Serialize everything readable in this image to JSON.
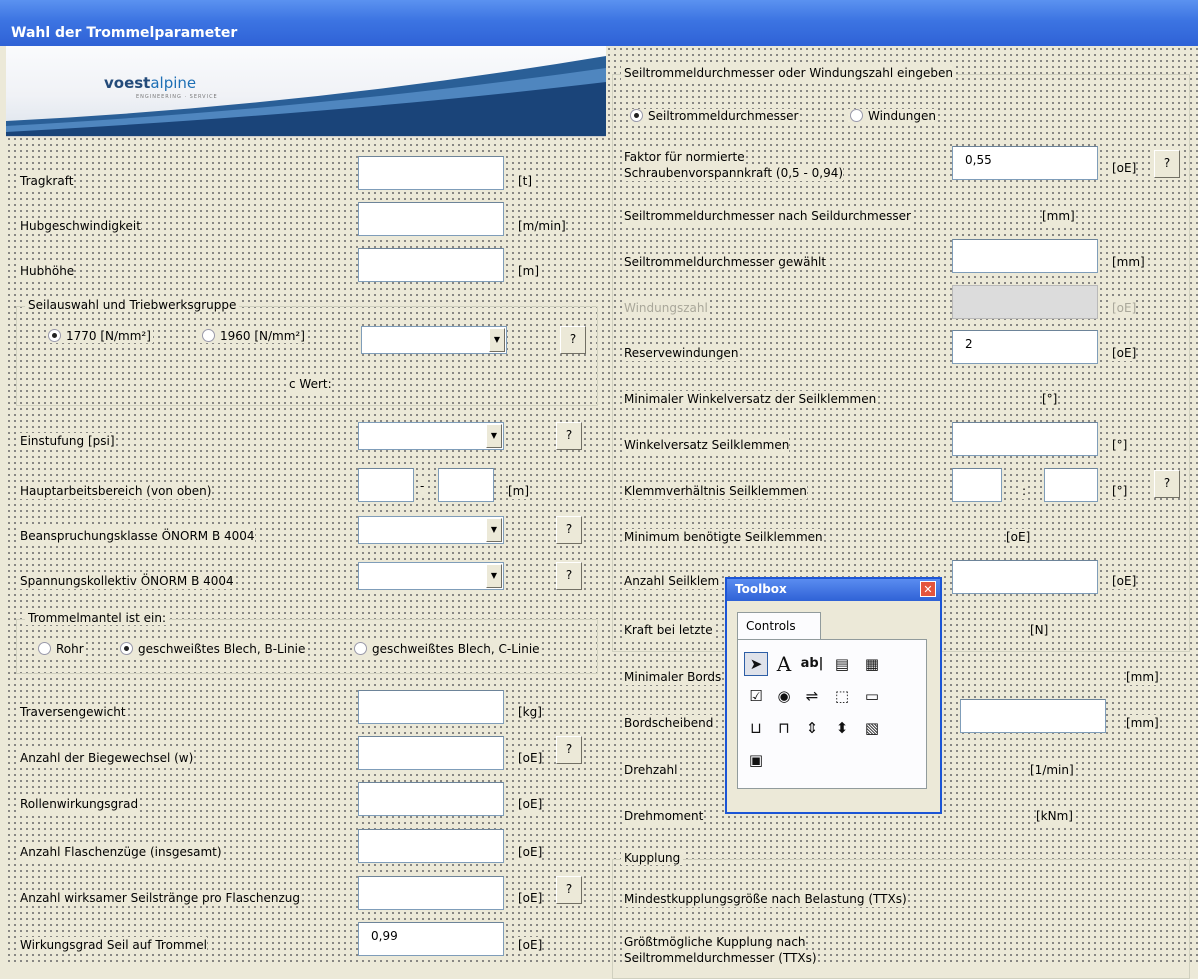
{
  "window": {
    "title": "Wahl der Trommelparameter"
  },
  "logo": {
    "brand_a": "voest",
    "brand_b": "alpine",
    "tagline": "ENGINEERING · SERVICE"
  },
  "left": {
    "tragkraft": {
      "label": "Tragkraft",
      "unit": "[t]"
    },
    "hubgeschw": {
      "label": "Hubgeschwindigkeit",
      "unit": "[m/min]"
    },
    "hubhoehe": {
      "label": "Hubhöhe",
      "unit": "[m]"
    },
    "seilauswahl": {
      "caption": "Seilauswahl und Triebwerksgruppe",
      "opt1": "1770 [N/mm²]",
      "opt2": "1960 [N/mm²]",
      "cwert": "c Wert:",
      "help": "?"
    },
    "einstufung": {
      "label": "Einstufung [psi]",
      "help": "?"
    },
    "hauptarbeit": {
      "label": "Hauptarbeitsbereich (von oben)",
      "sep": "-",
      "unit": "[m]"
    },
    "beanspruchung": {
      "label": "Beanspruchungsklasse ÖNORM B 4004",
      "help": "?"
    },
    "spannung": {
      "label": "Spannungskollektiv ÖNORM B 4004",
      "help": "?"
    },
    "trommelmantel": {
      "caption": "Trommelmantel ist ein:",
      "opt1": "Rohr",
      "opt2": "geschweißtes Blech, B-Linie",
      "opt3": "geschweißtes Blech, C-Linie"
    },
    "traverse": {
      "label": "Traversengewicht",
      "unit": "[kg]"
    },
    "biegewechsel": {
      "label": "Anzahl der Biegewechsel (w)",
      "unit": "[oE]",
      "help": "?"
    },
    "rollen": {
      "label": "Rollenwirkungsgrad",
      "unit": "[oE]"
    },
    "flaschenzuege": {
      "label": "Anzahl Flaschenzüge (insgesamt)",
      "unit": "[oE]"
    },
    "seilstraenge": {
      "label": "Anzahl wirksamer Seilstränge pro Flaschenzug",
      "unit": "[oE]",
      "help": "?"
    },
    "wirkungsgrad": {
      "label": "Wirkungsgrad Seil auf Trommel",
      "value": "0,99",
      "unit": "[oE]"
    }
  },
  "right": {
    "frame_caption": "Seiltrommeldurchmesser oder Windungszahl eingeben",
    "radio1": "Seiltrommeldurchmesser",
    "radio2": "Windungen",
    "faktor": {
      "label1": "Faktor für normierte",
      "label2": "Schraubenvorspannkraft (0,5 - 0,94)",
      "value": "0,55",
      "unit": "[oE]",
      "help": "?"
    },
    "std_nach": {
      "label": "Seiltrommeldurchmesser nach Seildurchmesser",
      "unit": "[mm]"
    },
    "std_gew": {
      "label": "Seiltrommeldurchmesser gewählt",
      "unit": "[mm]"
    },
    "windungszahl": {
      "label": "Windungszahl",
      "unit": "[oE]"
    },
    "reserve": {
      "label": "Reservewindungen",
      "value": "2",
      "unit": "[oE]"
    },
    "minwinkel": {
      "label": "Minimaler Winkelversatz der Seilklemmen",
      "unit": "[°]"
    },
    "winkel": {
      "label": "Winkelversatz Seilklemmen",
      "unit": "[°]"
    },
    "klemm": {
      "label": "Klemmverhältnis Seilklemmen",
      "sep": ":",
      "unit": "[°]",
      "help": "?"
    },
    "minklemm": {
      "label": "Minimum benötigte Seilklemmen",
      "unit": "[oE]"
    },
    "anzahlklemm": {
      "label": "Anzahl Seilklem",
      "unit": "[oE]"
    },
    "kraft": {
      "label": "Kraft bei letzte",
      "unit": "[N]"
    },
    "minbord": {
      "label": "Minimaler Bords",
      "unit": "[mm]"
    },
    "bord": {
      "label": "Bordscheibend",
      "unit": "[mm]"
    },
    "drehzahl": {
      "label": "Drehzahl",
      "unit": "[1/min]"
    },
    "drehmoment": {
      "label": "Drehmoment",
      "unit": "[kNm]"
    },
    "kupplung": {
      "caption": "Kupplung",
      "mindest": "Mindestkupplungsgröße nach Belastung (TTXs)",
      "groesst1": "Größtmögliche Kupplung nach",
      "groesst2": "Seiltrommeldurchmesser (TTXs)"
    }
  },
  "toolbox": {
    "title": "Toolbox",
    "tab": "Controls",
    "close": "✕",
    "tools": [
      "pointer-icon",
      "label-icon",
      "textbox-icon",
      "combobox-icon",
      "listbox-icon",
      "checkbox-icon",
      "optionbutton-icon",
      "togglebutton-icon",
      "frame-icon",
      "commandbutton-icon",
      "tabstrip-icon",
      "multipage-icon",
      "scrollbar-icon",
      "spinbutton-icon",
      "image-icon",
      "refedit-icon"
    ]
  }
}
